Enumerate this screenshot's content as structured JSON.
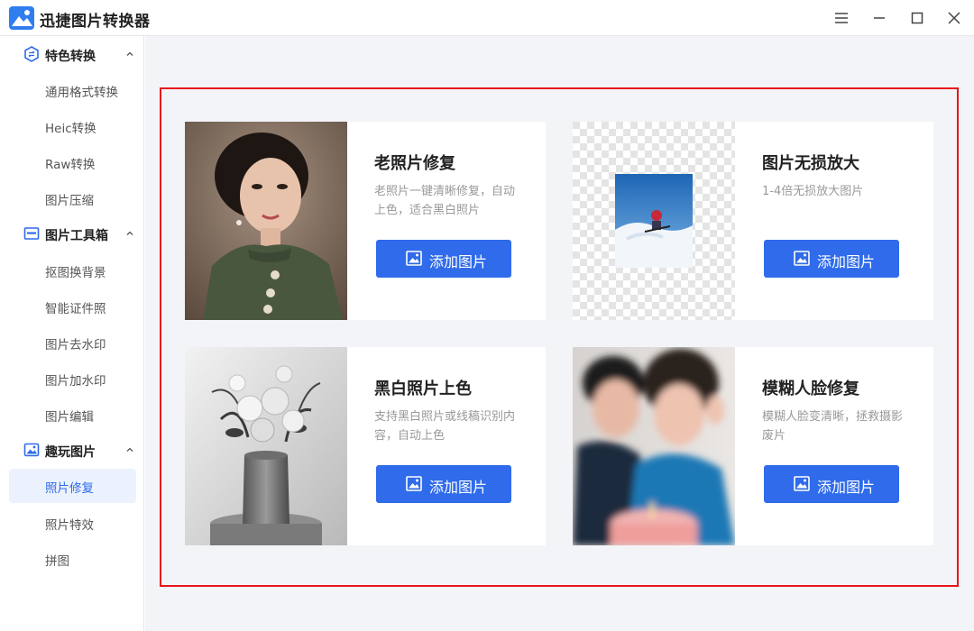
{
  "app": {
    "title": "迅捷图片转换器"
  },
  "window_controls": [
    "menu-icon",
    "minimize-icon",
    "maximize-icon",
    "close-icon"
  ],
  "sidebar": {
    "groups": [
      {
        "label": "特色转换",
        "icon": "convert-icon",
        "expanded": true,
        "items": [
          "通用格式转换",
          "Heic转换",
          "Raw转换",
          "图片压缩"
        ]
      },
      {
        "label": "图片工具箱",
        "icon": "toolbox-icon",
        "expanded": true,
        "items": [
          "抠图换背景",
          "智能证件照",
          "图片去水印",
          "图片加水印",
          "图片编辑"
        ]
      },
      {
        "label": "趣玩图片",
        "icon": "image-fun-icon",
        "expanded": true,
        "items": [
          "照片修复",
          "照片特效",
          "拼图"
        ]
      }
    ],
    "active_item": "照片修复"
  },
  "cards": [
    {
      "title": "老照片修复",
      "desc": "老照片一键清晰修复，自动上色，适合黑白照片",
      "button": "添加图片",
      "thumb": "vintage-portrait"
    },
    {
      "title": "图片无损放大",
      "desc": "1-4倍无损放大图片",
      "button": "添加图片",
      "thumb": "upscale-ski"
    },
    {
      "title": "黑白照片上色",
      "desc": "支持黑白照片或线稿识别内容，自动上色",
      "button": "添加图片",
      "thumb": "bw-flowers"
    },
    {
      "title": "模糊人脸修复",
      "desc": "模糊人脸变清晰，拯救摄影废片",
      "button": "添加图片",
      "thumb": "blurry-faces"
    }
  ],
  "colors": {
    "accent": "#2f6bea",
    "highlight_border": "#e8141b",
    "main_bg": "#f3f4f7"
  }
}
